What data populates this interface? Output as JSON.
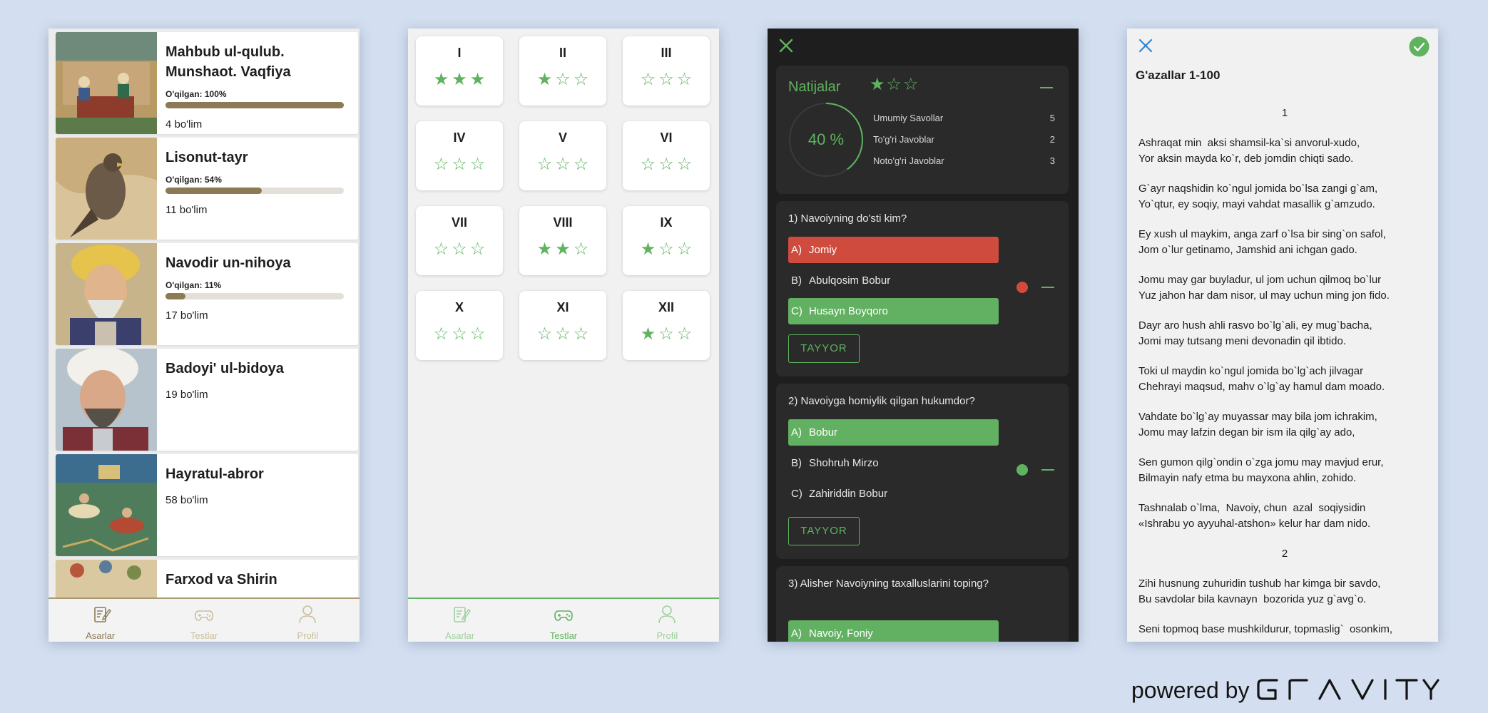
{
  "screen1": {
    "books": [
      {
        "title": "Mahbub ul-qulub. Munshaot. Vaqfiya",
        "progress_label": "O'qilgan: 100%",
        "progress": 1.0,
        "sections": "4 bo'lim",
        "thumb": "miniature-court-scene"
      },
      {
        "title": "Lisonut-tayr",
        "progress_label": "O'qilgan: 54%",
        "progress": 0.54,
        "sections": "11 bo'lim",
        "thumb": "miniature-falcon"
      },
      {
        "title": "Navodir un-nihoya",
        "progress_label": "O'qilgan: 11%",
        "progress": 0.11,
        "sections": "17 bo'lim",
        "thumb": "portrait-navoi-yellow-turban"
      },
      {
        "title": "Badoyi' ul-bidoya",
        "sections": "19 bo'lim",
        "thumb": "portrait-navoi-white-turban"
      },
      {
        "title": "Hayratul-abror",
        "sections": "58 bo'lim",
        "thumb": "miniature-battle-scene"
      },
      {
        "title": "Farxod va Shirin",
        "thumb": "miniature-pattern"
      }
    ],
    "tabs": [
      {
        "label": "Asarlar",
        "icon": "book-edit-icon",
        "active": true
      },
      {
        "label": "Testlar",
        "icon": "gamepad-icon",
        "active": false
      },
      {
        "label": "Profil",
        "icon": "user-icon",
        "active": false
      }
    ],
    "accent": "#8c7a55"
  },
  "screen2": {
    "levels": [
      {
        "label": "I",
        "stars": 3
      },
      {
        "label": "II",
        "stars": 1
      },
      {
        "label": "III",
        "stars": 0
      },
      {
        "label": "IV",
        "stars": 0
      },
      {
        "label": "V",
        "stars": 0
      },
      {
        "label": "VI",
        "stars": 0
      },
      {
        "label": "VII",
        "stars": 0
      },
      {
        "label": "VIII",
        "stars": 2
      },
      {
        "label": "IX",
        "stars": 1
      },
      {
        "label": "X",
        "stars": 0
      },
      {
        "label": "XI",
        "stars": 0
      },
      {
        "label": "XII",
        "stars": 1
      }
    ],
    "tabs": [
      {
        "label": "Asarlar",
        "icon": "book-edit-icon",
        "active": false
      },
      {
        "label": "Testlar",
        "icon": "gamepad-icon",
        "active": true
      },
      {
        "label": "Profil",
        "icon": "user-icon",
        "active": false
      }
    ],
    "accent": "#5fb35f"
  },
  "screen3": {
    "results": {
      "title": "Natijalar",
      "stars": 1,
      "percent_label": "40 %",
      "percent": 0.4,
      "stats": [
        {
          "label": "Umumiy Savollar",
          "value": "5"
        },
        {
          "label": "To'g'ri Javoblar",
          "value": "2"
        },
        {
          "label": "Noto'g'ri Javoblar",
          "value": "3"
        }
      ]
    },
    "questions": [
      {
        "text": "1) Navoiyning do'sti kim?",
        "options": [
          {
            "letter": "A)",
            "text": "Jomiy",
            "state": "red"
          },
          {
            "letter": "B)",
            "text": "Abulqosim Bobur",
            "state": "none"
          },
          {
            "letter": "C)",
            "text": "Husayn Boyqoro",
            "state": "green"
          }
        ],
        "button": "TAYYOR",
        "status_color": "#d34a3d"
      },
      {
        "text": "2) Navoiyga homiylik qilgan hukumdor?",
        "options": [
          {
            "letter": "A)",
            "text": "Bobur",
            "state": "green"
          },
          {
            "letter": "B)",
            "text": "Shohruh Mirzo",
            "state": "none"
          },
          {
            "letter": "C)",
            "text": "Zahiriddin Bobur",
            "state": "none"
          }
        ],
        "button": "TAYYOR",
        "status_color": "#5fb35f"
      },
      {
        "text": "3) Alisher Navoiyning taxalluslarini toping?",
        "options": [
          {
            "letter": "A)",
            "text": "Navoiy, Foniy",
            "state": "green"
          }
        ]
      }
    ]
  },
  "screen4": {
    "title": "G'azallar 1-100",
    "poems": [
      {
        "number": "1",
        "stanzas": [
          "Ashraqat min  aksi shamsil-ka`si anvorul-xudo,\nYor aksin mayda ko`r, deb jomdin chiqti sado.",
          "G`ayr naqshidin ko`ngul jomida bo`lsa zangi g`am,\nYo`qtur, ey soqiy, mayi vahdat masallik g`amzudo.",
          "Ey xush ul maykim, anga zarf o`lsa bir sing`on safol,\nJom o`lur getinamo, Jamshid ani ichgan gado.",
          "Jomu may gar buyladur, ul jom uchun qilmoq bo`lur\nYuz jahon har dam nisor, ul may uchun ming jon fido.",
          "Dayr aro hush ahli rasvo bo`lg`ali, ey mug`bacha,\nJomi may tutsang meni devonadin qil ibtido.",
          "Toki ul maydin ko`ngul jomida bo`lg`ach jilvagar\nChehrayi maqsud, mahv o`lg`ay hamul dam moado.",
          "Vahdate bo`lg`ay muyassar may bila jom ichrakim,\nJomu may lafzin degan bir ism ila qilg`ay ado,",
          "Sen gumon qilg`ondin o`zga jomu may mavjud erur,\nBilmayin nafy etma bu mayxona ahlin, zohido.",
          "Tashnalab o`lma,  Navoiy, chun  azal  soqiysidin\n«Ishrabu yo ayyuhal-atshon» kelur har dam nido."
        ]
      },
      {
        "number": "2",
        "stanzas": [
          "Zihi husnung zuhuridin tushub har kimga bir savdo,\nBu savdolar bila kavnayn  bozorida yuz g`avg`o.",
          "Seni topmoq base mushkildurur, topmaslig`  osonkim,"
        ]
      }
    ]
  },
  "footer": {
    "powered_by": "powered by",
    "brand": "GRAVITY"
  }
}
